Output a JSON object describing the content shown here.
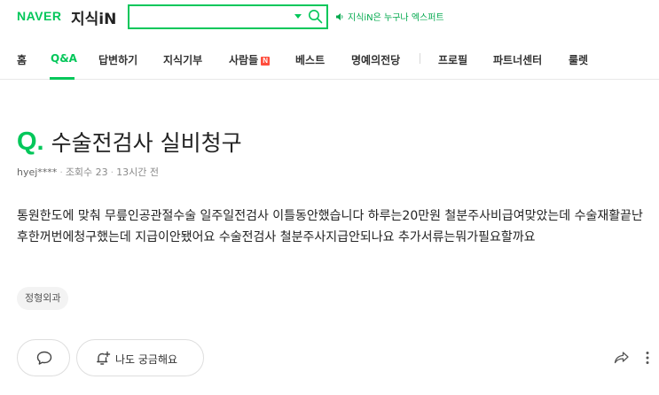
{
  "header": {
    "logo_naver": "NAVER",
    "logo_service": "지식iN",
    "search_placeholder": "",
    "notice": "지식iN은 누구나 엑스퍼트"
  },
  "nav": {
    "items": [
      {
        "label": "홈"
      },
      {
        "label": "Q&A",
        "active": true
      },
      {
        "label": "답변하기"
      },
      {
        "label": "지식기부"
      },
      {
        "label": "사람들",
        "badge": "N"
      },
      {
        "label": "베스트"
      },
      {
        "label": "명예의전당"
      },
      {
        "label": "프로필"
      },
      {
        "label": "파트너센터"
      },
      {
        "label": "룰렛"
      }
    ]
  },
  "question": {
    "mark": "Q.",
    "title": "수술전검사 실비청구",
    "author": "hyej****",
    "views": "조회수 23",
    "time": "13시간 전",
    "body": "통원한도에 맞춰 무릎인공관절수술 일주일전검사 이틀동안했습니다 하루는20만원 철분주사비급여맞았는데 수술재활끝난후한꺼번에청구했는데 지급이안됐어요 수술전검사 철분주사지급안되나요 추가서류는뭐가필요할까요",
    "tag": "정형외과"
  },
  "actions": {
    "curious_label": "나도 궁금해요"
  },
  "colors": {
    "accent": "#03c75a",
    "badge": "#ff4d3d"
  }
}
